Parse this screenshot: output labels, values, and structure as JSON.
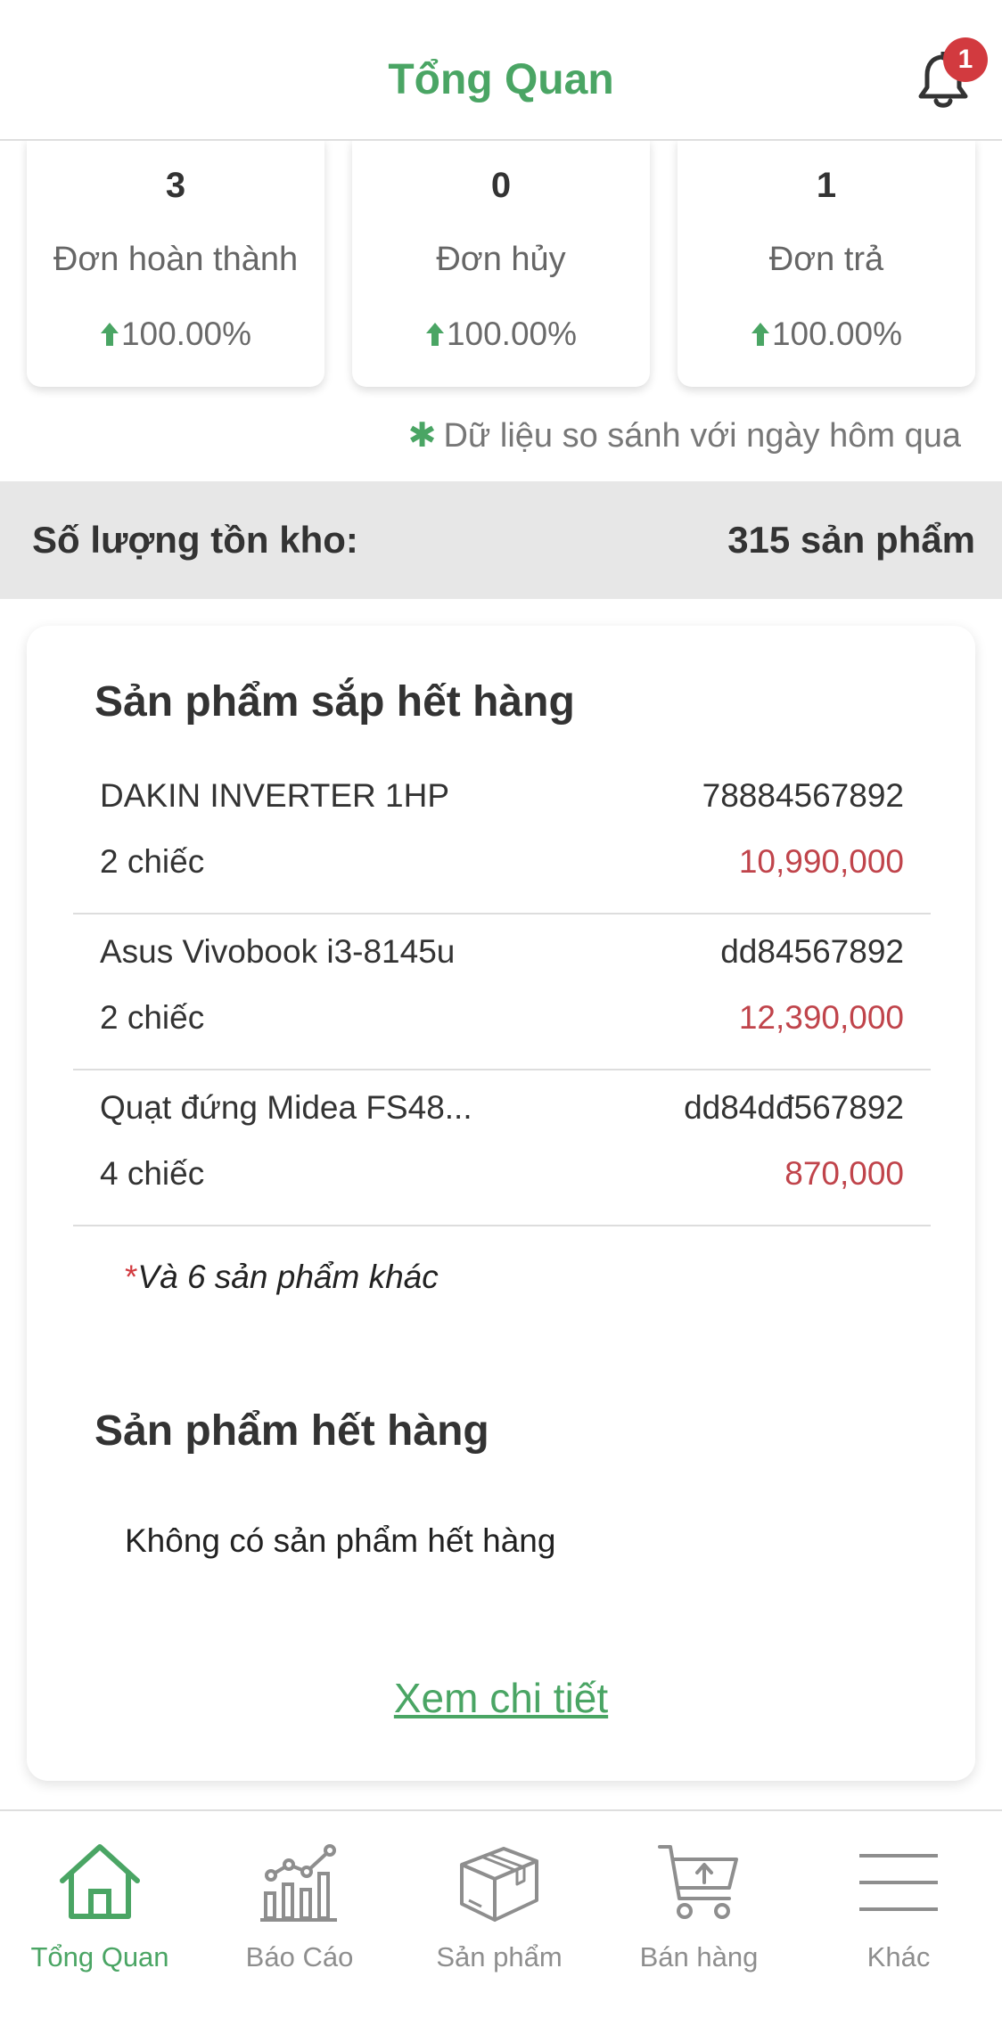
{
  "header": {
    "title": "Tổng Quan",
    "notification_count": "1"
  },
  "stats": [
    {
      "value": "3",
      "label": "Đơn hoàn thành",
      "change": "100.00%"
    },
    {
      "value": "0",
      "label": "Đơn hủy",
      "change": "100.00%"
    },
    {
      "value": "1",
      "label": "Đơn trả",
      "change": "100.00%"
    }
  ],
  "compare_note": {
    "star": "✱",
    "text": "Dữ liệu so sánh với ngày hôm qua"
  },
  "inventory": {
    "label": "Số lượng tồn kho:",
    "value": "315 sản phẩm"
  },
  "low_stock": {
    "title": "Sản phẩm sắp hết hàng",
    "items": [
      {
        "name": "DAKIN INVERTER 1HP",
        "code": "78884567892",
        "qty": "2 chiếc",
        "price": "10,990,000"
      },
      {
        "name": "Asus Vivobook i3-8145u",
        "code": "dd84567892",
        "qty": "2 chiếc",
        "price": "12,390,000"
      },
      {
        "name": "Quạt đứng Midea FS48...",
        "code": "dd84dđ567892",
        "qty": "4 chiếc",
        "price": "870,000"
      }
    ],
    "more_marker": "*",
    "more_text": "Và 6 sản phẩm khác"
  },
  "out_of_stock": {
    "title": "Sản phẩm hết hàng",
    "empty_text": "Không có sản phẩm hết hàng"
  },
  "detail_link": "Xem chi tiết",
  "tabs": [
    {
      "label": "Tổng Quan",
      "icon": "home-icon",
      "active": true
    },
    {
      "label": "Báo Cáo",
      "icon": "chart-icon",
      "active": false
    },
    {
      "label": "Sản phẩm",
      "icon": "box-icon",
      "active": false
    },
    {
      "label": "Bán hàng",
      "icon": "cart-icon",
      "active": false
    },
    {
      "label": "Khác",
      "icon": "menu-icon",
      "active": false
    }
  ],
  "colors": {
    "accent": "#4aa564",
    "price": "#c0444b",
    "badge": "#d23a3f"
  }
}
